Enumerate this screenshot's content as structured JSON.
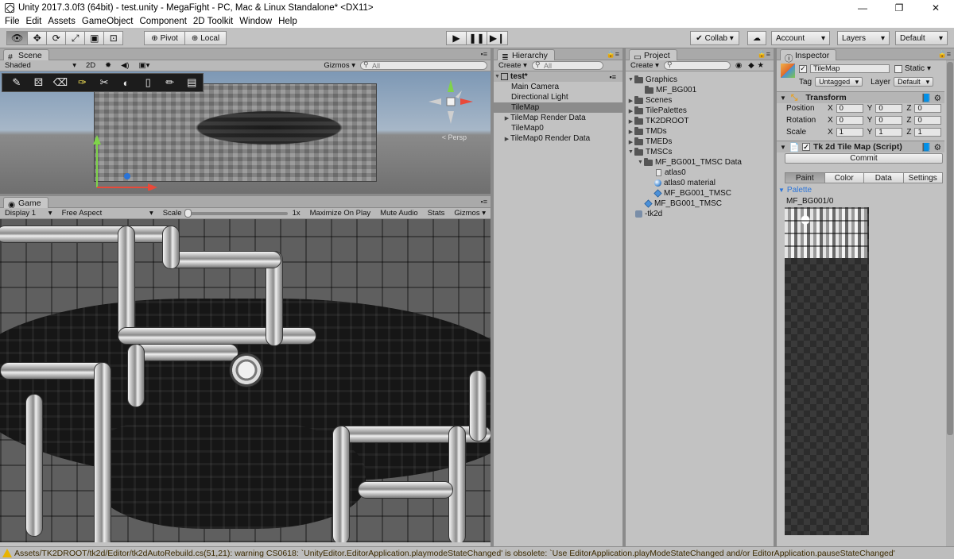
{
  "window": {
    "title": "Unity 2017.3.0f3 (64bit) - test.unity - MegaFight - PC, Mac & Linux Standalone* <DX11>"
  },
  "menu": [
    "File",
    "Edit",
    "Assets",
    "GameObject",
    "Component",
    "2D Toolkit",
    "Window",
    "Help"
  ],
  "toolbar": {
    "pivot": "Pivot",
    "local": "Local",
    "collab": "Collab ▾",
    "account": "Account",
    "layers": "Layers",
    "layout": "Default"
  },
  "scene": {
    "tab": "Scene",
    "shaded": "Shaded",
    "mode2d": "2D",
    "gizmos": "Gizmos",
    "search": "All",
    "persp": "< Persp"
  },
  "game": {
    "tab": "Game",
    "display": "Display 1",
    "aspect": "Free Aspect",
    "scale_label": "Scale",
    "scale_value": "1x",
    "maximize": "Maximize On Play",
    "mute": "Mute Audio",
    "stats": "Stats",
    "gizmos": "Gizmos"
  },
  "hierarchy": {
    "tab": "Hierarchy",
    "create": "Create",
    "search": "All",
    "scene_name": "test*",
    "items": [
      {
        "label": "Main Camera"
      },
      {
        "label": "Directional Light"
      },
      {
        "label": "TileMap"
      },
      {
        "label": "TileMap Render Data"
      },
      {
        "label": "TileMap0"
      },
      {
        "label": "TileMap0 Render Data"
      }
    ]
  },
  "project": {
    "tab": "Project",
    "create": "Create",
    "items": [
      {
        "label": "Graphics"
      },
      {
        "label": "MF_BG001"
      },
      {
        "label": "Scenes"
      },
      {
        "label": "TilePalettes"
      },
      {
        "label": "TK2DROOT"
      },
      {
        "label": "TMDs"
      },
      {
        "label": "TMEDs"
      },
      {
        "label": "TMSCs"
      },
      {
        "label": "MF_BG001_TMSC Data"
      },
      {
        "label": "atlas0"
      },
      {
        "label": "atlas0 material"
      },
      {
        "label": "MF_BG001_TMSC"
      },
      {
        "label": "MF_BG001_TMSC"
      },
      {
        "label": "-tk2d"
      }
    ]
  },
  "inspector": {
    "tab": "Inspector",
    "object_name": "TileMap",
    "static": "Static",
    "tag_label": "Tag",
    "tag_value": "Untagged",
    "layer_label": "Layer",
    "layer_value": "Default",
    "transform": {
      "title": "Transform",
      "position_label": "Position",
      "rotation_label": "Rotation",
      "scale_label": "Scale",
      "position": {
        "x": "0",
        "y": "0",
        "z": "0"
      },
      "rotation": {
        "x": "0",
        "y": "0",
        "z": "0"
      },
      "scale": {
        "x": "1",
        "y": "1",
        "z": "1"
      }
    },
    "script": {
      "title": "Tk 2d Tile Map (Script)",
      "commit": "Commit",
      "tabs": [
        "Paint",
        "Color",
        "Data",
        "Settings"
      ],
      "palette_label": "Palette",
      "palette_name": "MF_BG001/0"
    }
  },
  "status": {
    "message": "Assets/TK2DROOT/tk2d/Editor/tk2dAutoRebuild.cs(51,21): warning CS0618: `UnityEditor.EditorApplication.playmodeStateChanged' is obsolete: `Use EditorApplication.playModeStateChanged and/or EditorApplication.pauseStateChanged'"
  },
  "colors": {
    "panel": "#c2c2c2",
    "selected_row": "#8b8b8b",
    "accent_blue": "#2a74d9",
    "warning_text": "#3b2a00"
  }
}
